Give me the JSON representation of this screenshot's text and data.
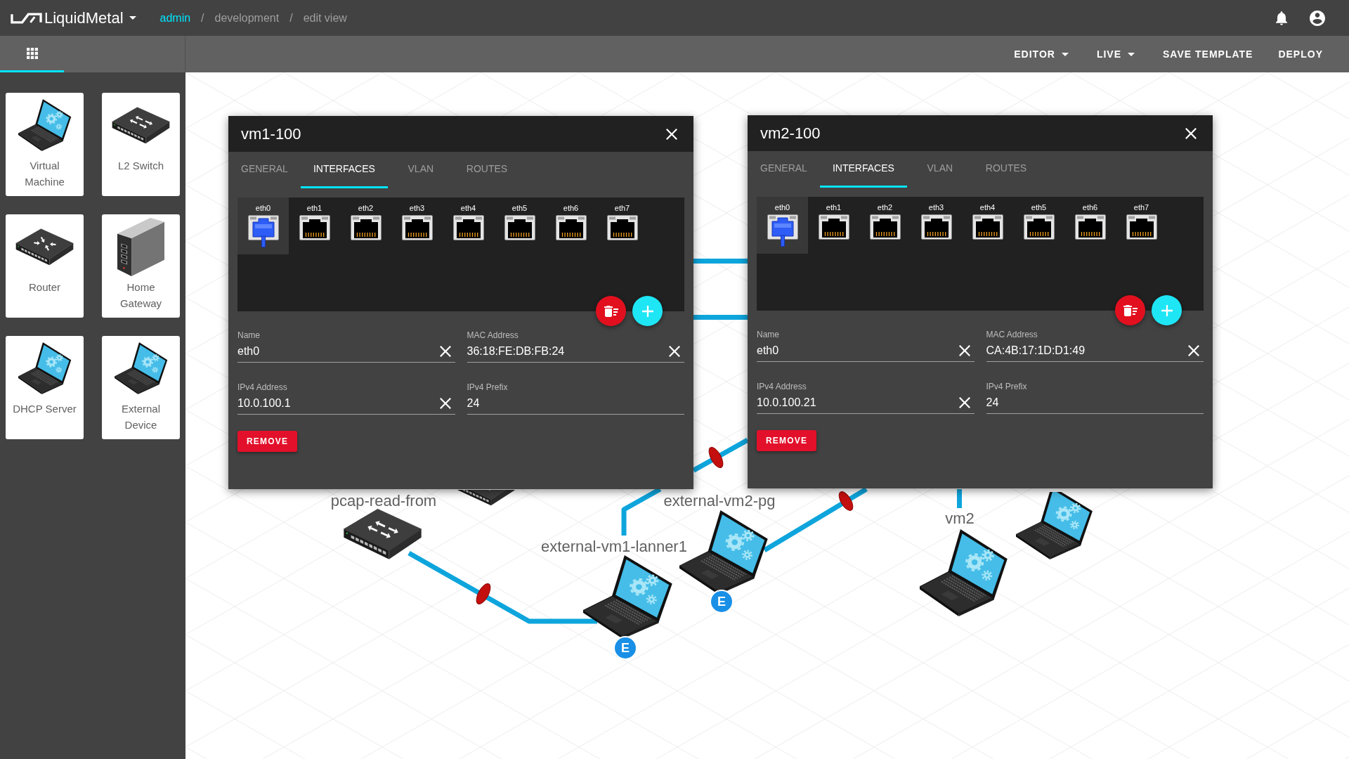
{
  "top_bar": {
    "app_name": "LiquidMetal",
    "breadcrumb": [
      {
        "label": "admin",
        "link": true
      },
      {
        "separator": "/",
        "label": "development",
        "link": false
      },
      {
        "separator": "/",
        "label": "edit view",
        "link": false
      }
    ]
  },
  "sidebar": {
    "tabs": [
      {
        "selected": true
      }
    ],
    "palette": [
      {
        "kind": "laptop",
        "label": "Virtual Machine"
      },
      {
        "kind": "switch",
        "label": "L2 Switch"
      },
      {
        "kind": "router",
        "label": "Router"
      },
      {
        "kind": "gateway",
        "label": "Home Gateway"
      },
      {
        "kind": "laptop",
        "label": "DHCP Server"
      },
      {
        "kind": "laptop",
        "label": "External Device"
      }
    ]
  },
  "toolbar": [
    {
      "label": "EDITOR",
      "dropdown": true
    },
    {
      "label": "LIVE",
      "dropdown": true
    },
    {
      "label": "SAVE TEMPLATE",
      "dropdown": false
    },
    {
      "label": "DEPLOY",
      "dropdown": false
    }
  ],
  "dialogs": [
    {
      "title": "vm1-100",
      "tabs": [
        {
          "label": "GENERAL",
          "selected": false
        },
        {
          "label": "INTERFACES",
          "selected": true
        },
        {
          "label": "VLAN",
          "selected": false
        },
        {
          "label": "ROUTES",
          "selected": false
        }
      ],
      "ports": [
        {
          "label": "eth0",
          "selected": true,
          "connected": true
        },
        {
          "label": "eth1",
          "selected": false,
          "connected": false
        },
        {
          "label": "eth2",
          "selected": false,
          "connected": false
        },
        {
          "label": "eth3",
          "selected": false,
          "connected": false
        },
        {
          "label": "eth4",
          "selected": false,
          "connected": false
        },
        {
          "label": "eth5",
          "selected": false,
          "connected": false
        },
        {
          "label": "eth6",
          "selected": false,
          "connected": false
        },
        {
          "label": "eth7",
          "selected": false,
          "connected": false
        }
      ],
      "fields": [
        {
          "label": "Name",
          "value": "eth0",
          "clearable": true
        },
        {
          "label": "MAC Address",
          "value": "36:18:FE:DB:FB:24",
          "clearable": true
        },
        {
          "label": "IPv4 Address",
          "value": "10.0.100.1",
          "clearable": true
        },
        {
          "label": "IPv4 Prefix",
          "value": "24",
          "clearable": false
        }
      ],
      "remove_button": "REMOVE"
    },
    {
      "title": "vm2-100",
      "tabs": [
        {
          "label": "GENERAL",
          "selected": false
        },
        {
          "label": "INTERFACES",
          "selected": true
        },
        {
          "label": "VLAN",
          "selected": false
        },
        {
          "label": "ROUTES",
          "selected": false
        }
      ],
      "ports": [
        {
          "label": "eth0",
          "selected": true,
          "connected": true
        },
        {
          "label": "eth1",
          "selected": false,
          "connected": false
        },
        {
          "label": "eth2",
          "selected": false,
          "connected": false
        },
        {
          "label": "eth3",
          "selected": false,
          "connected": false
        },
        {
          "label": "eth4",
          "selected": false,
          "connected": false
        },
        {
          "label": "eth5",
          "selected": false,
          "connected": false
        },
        {
          "label": "eth6",
          "selected": false,
          "connected": false
        },
        {
          "label": "eth7",
          "selected": false,
          "connected": false
        }
      ],
      "fields": [
        {
          "label": "Name",
          "value": "eth0",
          "clearable": true
        },
        {
          "label": "MAC Address",
          "value": "CA:4B:17:1D:D1:49",
          "clearable": true
        },
        {
          "label": "IPv4 Address",
          "value": "10.0.100.21",
          "clearable": true
        },
        {
          "label": "IPv4 Prefix",
          "value": "24",
          "clearable": false
        }
      ],
      "remove_button": "REMOVE"
    }
  ],
  "canvas": {
    "nodes": [
      {
        "kind": "switch",
        "label": "pcap-read-from"
      },
      {
        "kind": "switch"
      },
      {
        "kind": "laptop",
        "label": "external-vm1-lanner1",
        "badge": "E"
      },
      {
        "kind": "laptop",
        "label": "external-vm2-pg",
        "badge": "E"
      },
      {
        "kind": "laptop",
        "label": "vm2"
      },
      {
        "kind": "laptop"
      }
    ]
  }
}
